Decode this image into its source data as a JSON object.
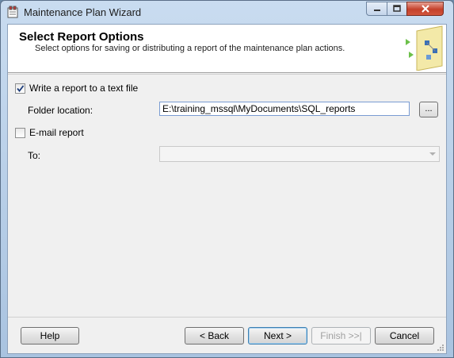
{
  "window": {
    "title": "Maintenance Plan Wizard"
  },
  "header": {
    "title": "Select Report Options",
    "subtitle": "Select options for saving or distributing a report of the maintenance plan actions."
  },
  "report_text_file": {
    "label": "Write a report to a text file",
    "checked": true
  },
  "folder_location": {
    "label": "Folder location:",
    "value": "E:\\training_mssql\\MyDocuments\\SQL_reports",
    "browse_label": "..."
  },
  "email_report": {
    "label": "E-mail report",
    "checked": false
  },
  "to_field": {
    "label": "To:",
    "value": ""
  },
  "buttons": {
    "help": "Help",
    "back": "< Back",
    "next": "Next >",
    "finish": "Finish >>|",
    "cancel": "Cancel"
  }
}
